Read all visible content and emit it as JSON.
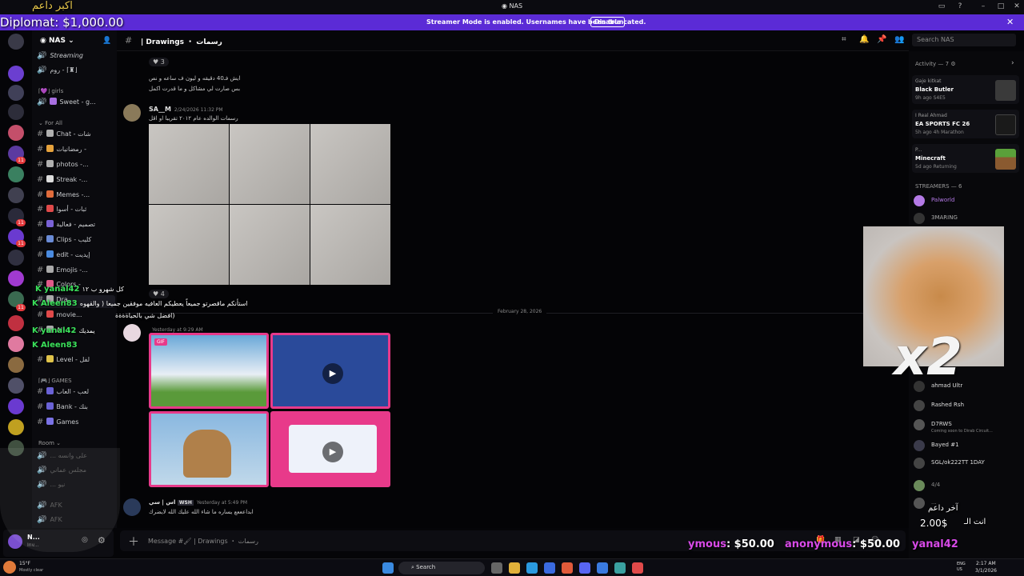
{
  "window": {
    "title": "NAS"
  },
  "banner": {
    "message": "Streamer Mode is enabled. Usernames have been truncated.",
    "disable_label": "Disable"
  },
  "overlay": {
    "top_arabic": "اكبر داعم",
    "diplomat": "Diplomat: $1,000.00",
    "stream_chat": [
      {
        "user": "yanal42",
        "text": "كل شهرو ب ١٢"
      },
      {
        "user": "Aleen83",
        "text": "استأنكم ماقصرتو جميعاً يعطيكم العافيه موفقين جميعا ( والقهوه"
      },
      {
        "user": "",
        "text": "افضل شي بالحياةةةة)"
      },
      {
        "user": "yanal42",
        "text": "يمديك"
      },
      {
        "user": "Aleen83",
        "text": ""
      }
    ],
    "x2": "x2",
    "donation1_name": "ymous",
    "donation1_amount": ": $50.00",
    "donation2_name": "anonymous",
    "donation2_amount": ": $50.00",
    "donation3_name": "yanal42",
    "bottom_arabic1": "آخر داعم",
    "bottom_arabic2": "انت الـ",
    "bottom_amount": "2.00$"
  },
  "server": {
    "name": "NAS",
    "categories": {
      "girls": "girls",
      "for_all": "For All",
      "games": "GAMES",
      "room": "Room"
    },
    "channels": [
      {
        "label": "Streaming",
        "color": "#8a8a8a"
      },
      {
        "label": "روم - ⌈♜⌋",
        "color": "#8a8a8a"
      },
      {
        "label": "Sweet - g...",
        "color": "#a86fe0"
      },
      {
        "label": "Chat - شات",
        "color": "#b0b0b0"
      },
      {
        "label": "رمضانيات -",
        "color": "#e6a23c"
      },
      {
        "label": "photos -...",
        "color": "#b0b0b0"
      },
      {
        "label": "Streak -...",
        "color": "#ddd"
      },
      {
        "label": "Memes -...",
        "color": "#e06c3c"
      },
      {
        "label": "ثبات - أسوا",
        "color": "#e04a4a"
      },
      {
        "label": "تصميم - فعالية",
        "color": "#7a62d6"
      },
      {
        "label": "Clips - كليب",
        "color": "#6a8bd6"
      },
      {
        "label": "edit - إيديت",
        "color": "#4a8be0"
      },
      {
        "label": "Emojis -...",
        "color": "#aaa"
      },
      {
        "label": "Colors -",
        "color": "#e05a8a"
      },
      {
        "label": "Dra...",
        "color": "#aaa"
      },
      {
        "label": "movie...",
        "color": "#e04a4a"
      },
      {
        "label": "AI - ...",
        "color": "#aaa"
      },
      {
        "label": "Level - لفل",
        "color": "#e0c34a"
      },
      {
        "label": "لعب - العاب",
        "color": "#6a62d6"
      },
      {
        "label": "Bank - بنك",
        "color": "#6a62d6"
      },
      {
        "label": "Games",
        "color": "#7a72e6"
      }
    ],
    "voice": [
      "... على وانسه",
      "مجلس عماني",
      "... نيو",
      "AFK",
      "AFK"
    ]
  },
  "channel": {
    "name": "| Drawings ・ رسمات",
    "search_placeholder": "Search NAS"
  },
  "messages": {
    "m1_react": "3",
    "m1_line1": "ايش فـ40 دقيقه و ليون ف ساعه و نص",
    "m1_line2": "بس صارت لي مشاكل و ما قدرت اكمل",
    "m2_author": "SA__M",
    "m2_time": "2/24/2026 11:32 PM",
    "m2_text": "رسمات الوالده عام ٢٠١٢ تقريبا او اقل",
    "m2_react": "4",
    "divider": "February 28, 2026",
    "m3_time": "Yesterday at 9:29 AM",
    "m4_author": "اس | سي",
    "m4_tag": "WSH",
    "m4_time": "Yesterday at 5:49 PM",
    "m4_text": "ابداعععع يساره ما شاء الله عليك الله لايضرك",
    "gif_label": "GIF",
    "composer": "Message #🖌 | Drawings ・ رسمات"
  },
  "members": {
    "activity_header": "Activity — 7",
    "activities": [
      {
        "user": "Gaje kitkat",
        "game": "Black Butler",
        "time": "9h ago  S4E5"
      },
      {
        "user": "I Real Ahmad",
        "game": "EA SPORTS FC 26",
        "time": "5h ago  4h Marathon"
      },
      {
        "user": "P...",
        "game": "Minecraft",
        "time": "5d ago  Returning"
      }
    ],
    "streamers_header": "STREAMERS — 6",
    "list": [
      {
        "name": "Palworld",
        "color": "#b47ae6"
      },
      {
        "name": "3MARING",
        "color": "#aaa"
      },
      {
        "name": "ahmad  Ultr",
        "color": "#ddd"
      },
      {
        "name": "Rashed  Rsh",
        "color": "#ddd"
      },
      {
        "name": "D7RWS",
        "color": "#ddd"
      },
      {
        "name": "Bayed  #1",
        "color": "#ddd"
      },
      {
        "name": "SGL/ok222TT  1DAY",
        "color": "#ddd"
      },
      {
        "name": "4/4",
        "color": "#888"
      },
      {
        "name": "...",
        "color": "#888"
      }
    ],
    "sub_line": "Coming soon to Dirab Circuit..."
  },
  "user_panel": {
    "name": "N...",
    "status": "Inv..."
  },
  "taskbar": {
    "search": "Search",
    "temp": "15°F",
    "weather": "Mostly clear",
    "lang": "ENG US",
    "time": "2:17 AM",
    "date": "3/1/2026"
  }
}
